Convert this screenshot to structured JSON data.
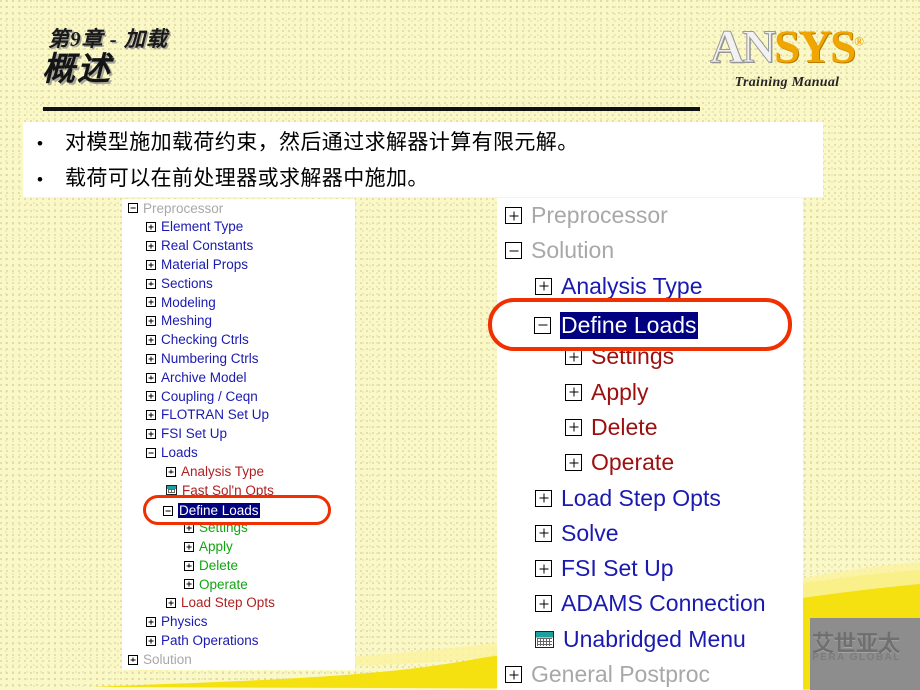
{
  "slide": {
    "chapter_title": "第9章 - 加载",
    "section_title": "概述",
    "bullets": [
      {
        "marker": "•",
        "text": "对模型施加载荷约束，然后通过求解器计算有限元解。"
      },
      {
        "marker": "•",
        "text": "载荷可以在前处理器或求解器中施加。"
      }
    ]
  },
  "logo": {
    "part_light": "AN",
    "part_gold": "SYS",
    "registered": "®",
    "subtitle": "Training Manual"
  },
  "colors": {
    "background": "#fbf8c8",
    "panel": "#ffffff",
    "accent_gold": "#f0a500",
    "highlight_ring": "#f03000",
    "selection": "#000080",
    "tree_blue": "#1a1ab0",
    "tree_red": "#9c1010",
    "tree_green": "#00a000",
    "tree_gray": "#a8a8a8",
    "swoosh": "#f5e010"
  },
  "tree_left": {
    "items": [
      {
        "label": "Preprocessor",
        "icon": "minus-box-icon",
        "level": 0,
        "color": "c-gray"
      },
      {
        "label": "Element Type",
        "icon": "plus-box-icon",
        "level": 1,
        "color": "c-blue"
      },
      {
        "label": "Real Constants",
        "icon": "plus-box-icon",
        "level": 1,
        "color": "c-blue"
      },
      {
        "label": "Material Props",
        "icon": "plus-box-icon",
        "level": 1,
        "color": "c-blue"
      },
      {
        "label": "Sections",
        "icon": "plus-box-icon",
        "level": 1,
        "color": "c-blue"
      },
      {
        "label": "Modeling",
        "icon": "plus-box-icon",
        "level": 1,
        "color": "c-blue"
      },
      {
        "label": "Meshing",
        "icon": "plus-box-icon",
        "level": 1,
        "color": "c-blue"
      },
      {
        "label": "Checking Ctrls",
        "icon": "plus-box-icon",
        "level": 1,
        "color": "c-blue"
      },
      {
        "label": "Numbering Ctrls",
        "icon": "plus-box-icon",
        "level": 1,
        "color": "c-blue"
      },
      {
        "label": "Archive Model",
        "icon": "plus-box-icon",
        "level": 1,
        "color": "c-blue"
      },
      {
        "label": "Coupling / Ceqn",
        "icon": "plus-box-icon",
        "level": 1,
        "color": "c-blue"
      },
      {
        "label": "FLOTRAN Set Up",
        "icon": "plus-box-icon",
        "level": 1,
        "color": "c-blue"
      },
      {
        "label": "FSI Set Up",
        "icon": "plus-box-icon",
        "level": 1,
        "color": "c-blue"
      },
      {
        "label": "Loads",
        "icon": "minus-box-icon",
        "level": 1,
        "color": "c-blue"
      },
      {
        "label": "Analysis Type",
        "icon": "plus-box-icon",
        "level": 2,
        "color": "c-red"
      },
      {
        "label": "Fast Sol'n Opts",
        "icon": "menu-grid-icon",
        "level": 2,
        "color": "c-red"
      },
      {
        "label": "Define Loads",
        "icon": "minus-box-icon",
        "level": 2,
        "color": "c-sel"
      },
      {
        "label": "Settings",
        "icon": "plus-box-icon",
        "level": 3,
        "color": "c-green"
      },
      {
        "label": "Apply",
        "icon": "plus-box-icon",
        "level": 3,
        "color": "c-green"
      },
      {
        "label": "Delete",
        "icon": "plus-box-icon",
        "level": 3,
        "color": "c-green"
      },
      {
        "label": "Operate",
        "icon": "plus-box-icon",
        "level": 3,
        "color": "c-green"
      },
      {
        "label": "Load Step Opts",
        "icon": "plus-box-icon",
        "level": 2,
        "color": "c-red"
      },
      {
        "label": "Physics",
        "icon": "plus-box-icon",
        "level": 1,
        "color": "c-blue"
      },
      {
        "label": "Path Operations",
        "icon": "plus-box-icon",
        "level": 1,
        "color": "c-blue"
      },
      {
        "label": "Solution",
        "icon": "plus-box-icon",
        "level": 0,
        "color": "c-gray"
      }
    ],
    "highlighted_item": "Define Loads"
  },
  "tree_right": {
    "items": [
      {
        "label": "Preprocessor",
        "icon": "plus-box-icon",
        "level": 0,
        "color": "c-gray"
      },
      {
        "label": "Solution",
        "icon": "minus-box-icon",
        "level": 0,
        "color": "c-gray"
      },
      {
        "label": "Analysis Type",
        "icon": "plus-box-icon",
        "level": 1,
        "color": "c-blue"
      },
      {
        "label": "Define Loads",
        "icon": "minus-box-icon",
        "level": 1,
        "color": "c-sel"
      },
      {
        "label": "Settings",
        "icon": "plus-box-icon",
        "level": 2,
        "color": "c-red"
      },
      {
        "label": "Apply",
        "icon": "plus-box-icon",
        "level": 2,
        "color": "c-red"
      },
      {
        "label": "Delete",
        "icon": "plus-box-icon",
        "level": 2,
        "color": "c-red"
      },
      {
        "label": "Operate",
        "icon": "plus-box-icon",
        "level": 2,
        "color": "c-red"
      },
      {
        "label": "Load Step Opts",
        "icon": "plus-box-icon",
        "level": 1,
        "color": "c-blue"
      },
      {
        "label": "Solve",
        "icon": "plus-box-icon",
        "level": 1,
        "color": "c-blue"
      },
      {
        "label": "FSI Set Up",
        "icon": "plus-box-icon",
        "level": 1,
        "color": "c-blue"
      },
      {
        "label": "ADAMS Connection",
        "icon": "plus-box-icon",
        "level": 1,
        "color": "c-blue"
      },
      {
        "label": "Unabridged Menu",
        "icon": "menu-grid-icon",
        "level": 1,
        "color": "c-blue"
      },
      {
        "label": "General Postproc",
        "icon": "plus-box-icon",
        "level": 0,
        "color": "c-gray"
      }
    ],
    "highlighted_item": "Define Loads"
  },
  "watermark": {
    "chinese": "艾世亚太",
    "english": "PERA GLOBAL"
  }
}
